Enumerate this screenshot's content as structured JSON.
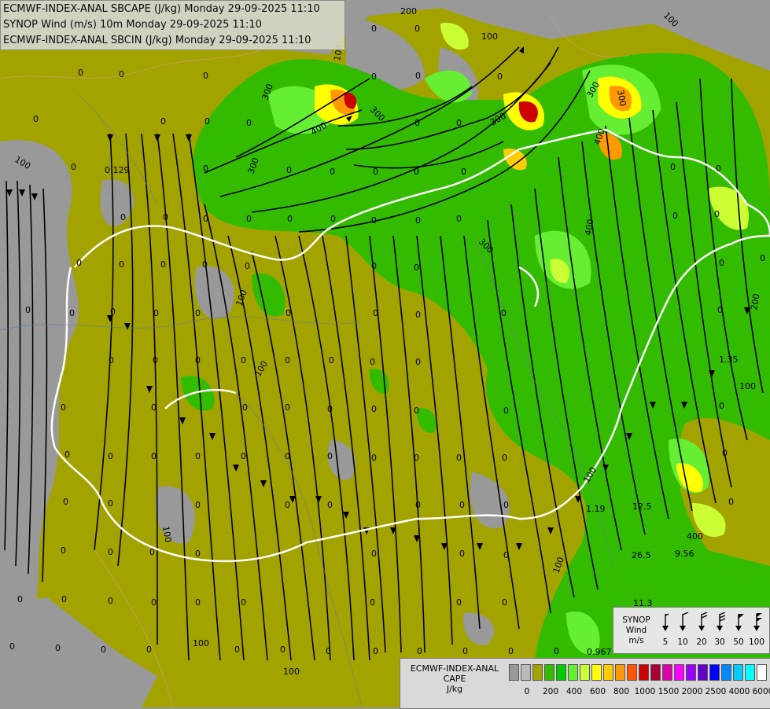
{
  "header": {
    "line1": "ECMWF-INDEX-ANAL SBCAPE (J/kg) Monday 29-09-2025 11:10",
    "line2": "SYNOP Wind (m/s) 10m Monday 29-09-2025 11:10",
    "line3": "ECMWF-INDEX-ANAL SBCIN (J/kg) Monday 29-09-2025 11:10"
  },
  "synop_legend": {
    "title1": "SYNOP",
    "title2": "Wind",
    "unit": "m/s",
    "values": [
      "5",
      "10",
      "20",
      "30",
      "50",
      "100"
    ]
  },
  "cape_legend": {
    "title1": "ECMWF-INDEX-ANAL",
    "title2": "CAPE",
    "unit": "J/kg",
    "colors": [
      "#999999",
      "#bbbbbb",
      "#a3a300",
      "#33bb00",
      "#00cc00",
      "#66ee33",
      "#ccff33",
      "#ffff00",
      "#ffcc00",
      "#ff9900",
      "#ff5500",
      "#cc0000",
      "#aa0033",
      "#dd00aa",
      "#ff00ff",
      "#9900ff",
      "#6600cc",
      "#0000ff",
      "#0088ff",
      "#00ccff",
      "#00ffff",
      "#ffffff"
    ],
    "ticks": [
      "0",
      "200",
      "400",
      "600",
      "800",
      "1000",
      "1500",
      "2000",
      "2500",
      "4000",
      "6000"
    ]
  },
  "map_labels": {
    "zeros": "0",
    "contour_100": "100",
    "contour_200": "200",
    "contour_300": "300",
    "contour_400": "400",
    "val_0129": "0.129",
    "val_135": "1.35",
    "val_119": "1.19",
    "val_125": "12.5",
    "val_265": "26.5",
    "val_956": "9.56",
    "val_113": "11.3",
    "val_0967": "0.967"
  },
  "colors": {
    "olive": "#a3a300",
    "gray": "#999999",
    "green": "#33bb00",
    "bright_green": "#00cc00",
    "light_green": "#66ee33",
    "yellow_green": "#ccff33",
    "yellow": "#ffff00",
    "orange": "#ff9900",
    "dark_red": "#cc0000"
  }
}
